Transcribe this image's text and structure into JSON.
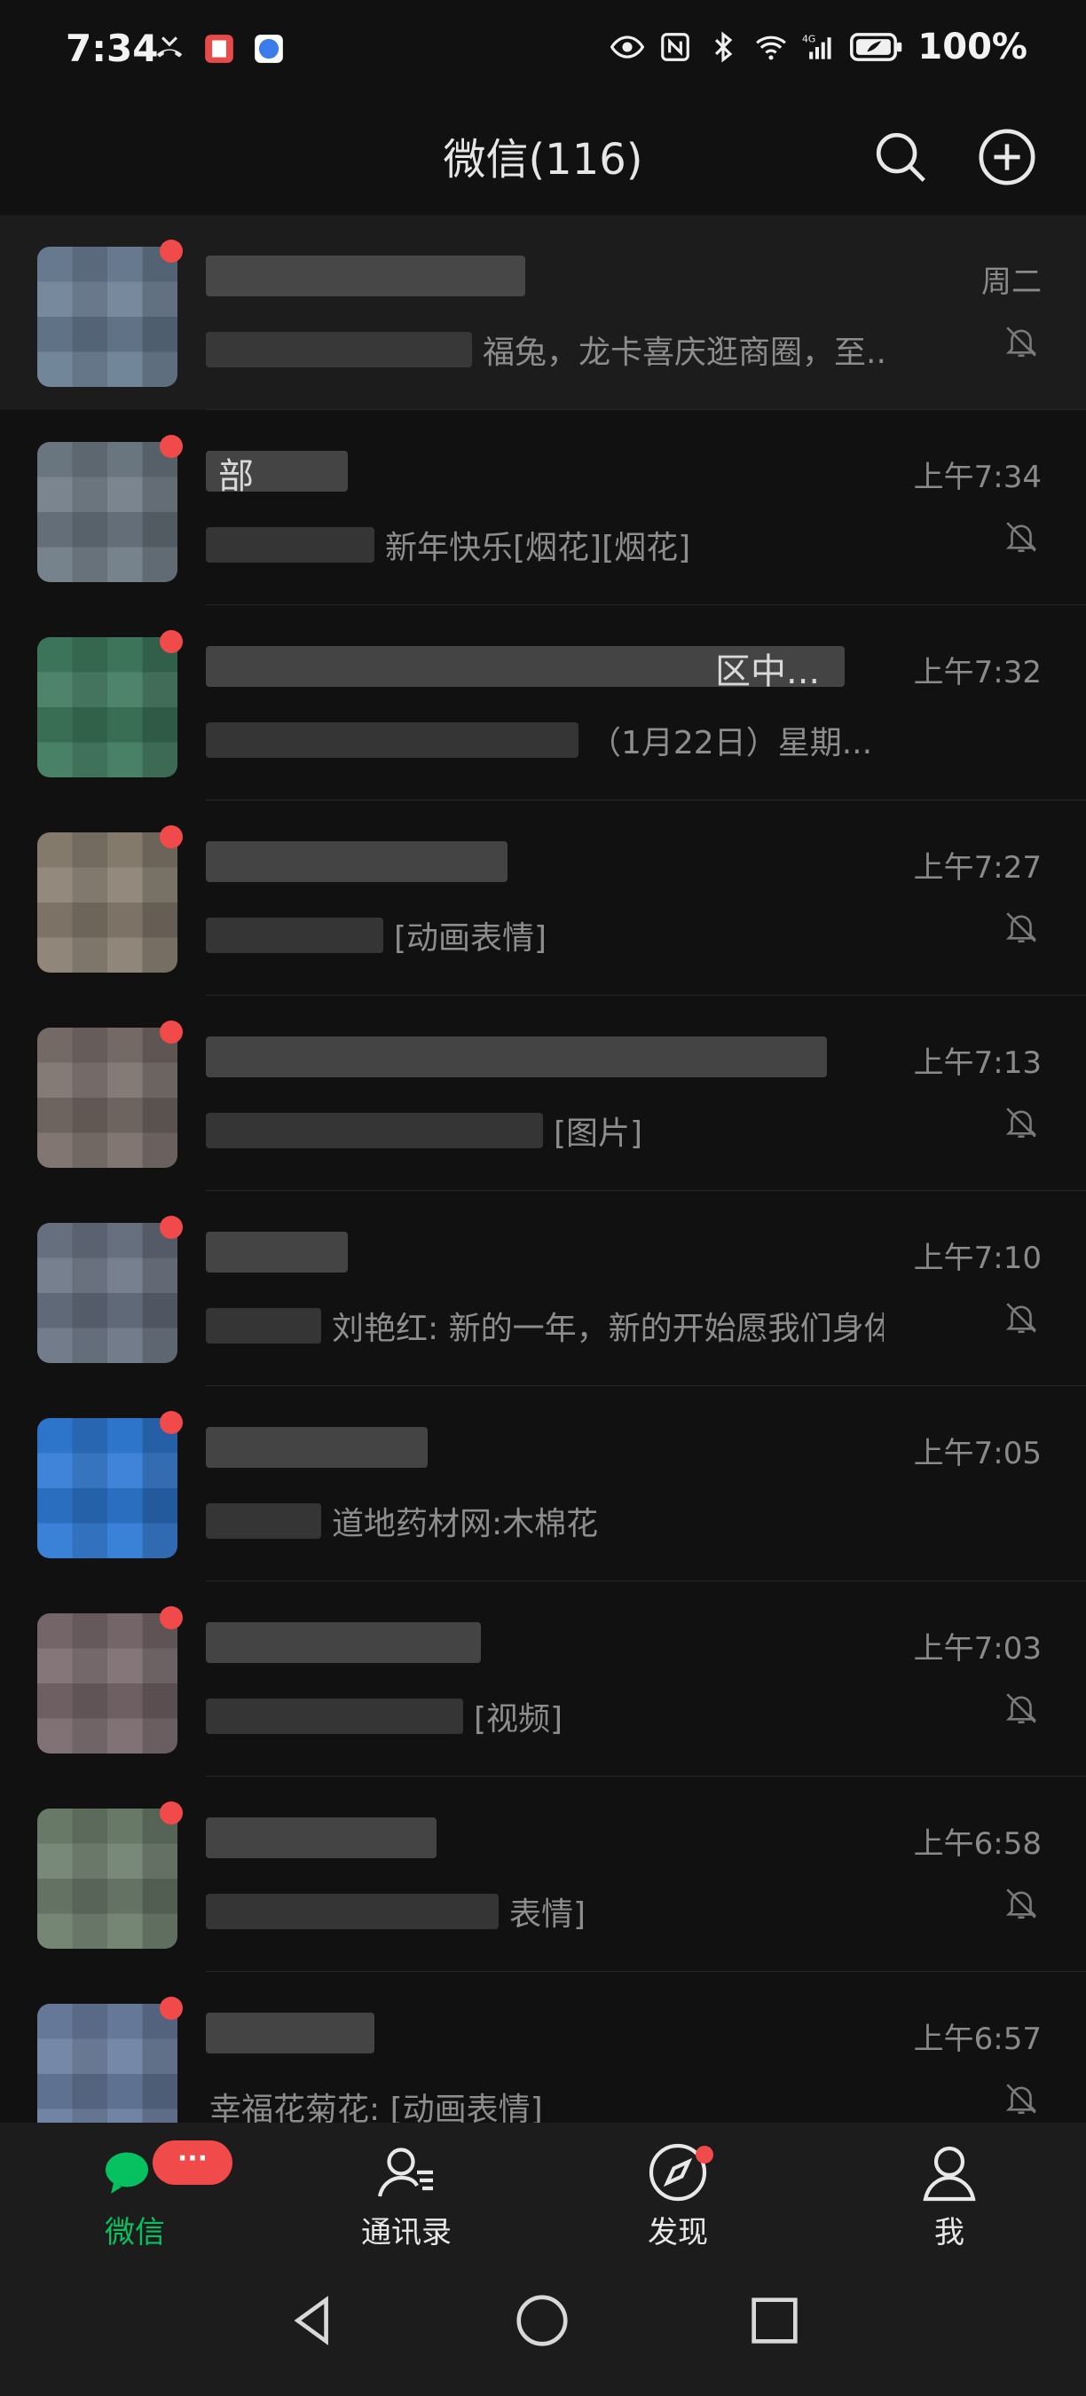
{
  "status_bar": {
    "time": "7:34",
    "network": "4G",
    "battery": "100%"
  },
  "header": {
    "title": "微信(116)"
  },
  "chats": [
    {
      "name": "",
      "preview": "福兔，龙卡喜庆逛商圈，至...",
      "time": "周二",
      "muted": true,
      "pinned": true,
      "avatar_color": "#6b7f95"
    },
    {
      "name": "部",
      "preview": "新年快乐[烟花][烟花]",
      "time": "上午7:34",
      "muted": true,
      "pinned": false,
      "avatar_color": "#6f7b86"
    },
    {
      "name": "区中...",
      "preview": "（1月22日）星期...",
      "time": "上午7:32",
      "muted": false,
      "pinned": false,
      "avatar_color": "#3f7a5e"
    },
    {
      "name": "",
      "preview": "[动画表情]",
      "time": "上午7:27",
      "muted": true,
      "pinned": false,
      "avatar_color": "#8a8072"
    },
    {
      "name": "",
      "preview": "[图片]",
      "time": "上午7:13",
      "muted": true,
      "pinned": false,
      "avatar_color": "#7a6f6a"
    },
    {
      "name": "",
      "preview": "刘艳红: 新的一年，新的开始愿我们身体...",
      "time": "上午7:10",
      "muted": true,
      "pinned": false,
      "avatar_color": "#6b7585"
    },
    {
      "name": "",
      "preview": "道地药材网:木棉花",
      "time": "上午7:05",
      "muted": false,
      "pinned": false,
      "avatar_color": "#2f7ad6"
    },
    {
      "name": "",
      "preview": "[视频]",
      "time": "上午7:03",
      "muted": true,
      "pinned": false,
      "avatar_color": "#7a6a6e"
    },
    {
      "name": "",
      "preview": "表情]",
      "time": "上午6:58",
      "muted": true,
      "pinned": false,
      "avatar_color": "#6e7f6e"
    },
    {
      "name": "",
      "preview": "幸福花菊花: [动画表情]",
      "time": "上午6:57",
      "muted": true,
      "pinned": false,
      "avatar_color": "#6a7ea0"
    }
  ],
  "tabs": [
    {
      "label": "微信",
      "active": true,
      "badge": "···"
    },
    {
      "label": "通讯录",
      "active": false
    },
    {
      "label": "发现",
      "active": false
    },
    {
      "label": "我",
      "active": false
    }
  ],
  "colors": {
    "accent": "#07c160",
    "badge": "#f04a4a",
    "background": "#111111"
  }
}
